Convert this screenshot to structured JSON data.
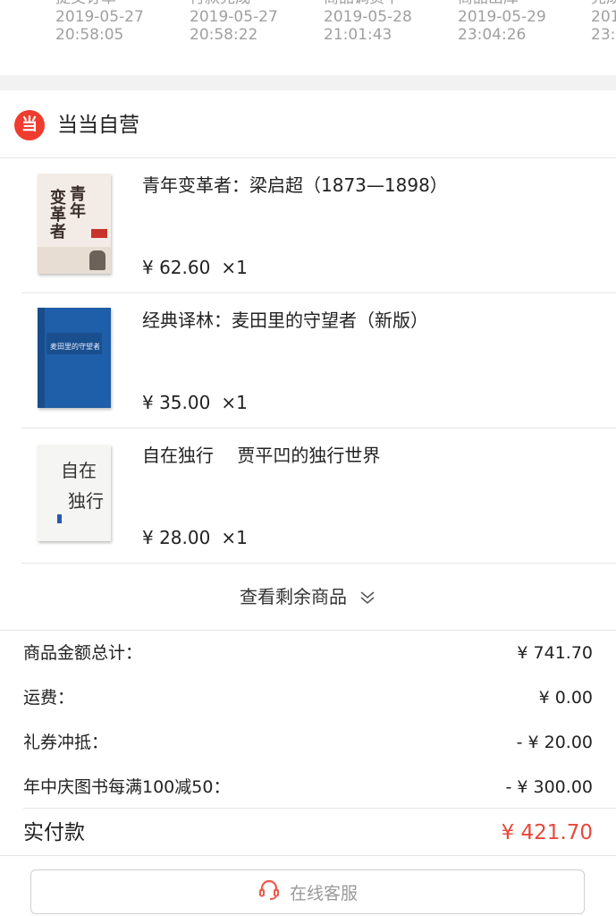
{
  "timeline": {
    "steps": [
      {
        "label": "提交订单",
        "date": "2019-05-27",
        "time": "20:58:05"
      },
      {
        "label": "付款完成",
        "date": "2019-05-27",
        "time": "20:58:22"
      },
      {
        "label": "商品调货中",
        "date": "2019-05-28",
        "time": "21:01:43"
      },
      {
        "label": "商品出库",
        "date": "2019-05-29",
        "time": "23:04:26"
      },
      {
        "label": "完成",
        "date": "201",
        "time": "23:5"
      }
    ]
  },
  "store": {
    "logo_char": "当",
    "name": "当当自营"
  },
  "items": [
    {
      "title": "青年变革者：梁启超（1873—1898）",
      "price": "¥ 62.60",
      "qty": "×1",
      "cover_text": "青年变革者"
    },
    {
      "title": "经典译林：麦田里的守望者（新版）",
      "price": "¥ 35.00",
      "qty": "×1",
      "cover_text": "麦田里的守望者"
    },
    {
      "title": "自在独行　 贾平凹的独行世界",
      "price": "¥ 28.00",
      "qty": "×1",
      "cover_text": "自在独行"
    }
  ],
  "show_more": {
    "label": "查看剩余商品"
  },
  "summary": [
    {
      "label": "商品金额总计：",
      "value": "¥ 741.70"
    },
    {
      "label": "运费：",
      "value": "¥ 0.00"
    },
    {
      "label": "礼券冲抵：",
      "value": "- ¥ 20.00"
    },
    {
      "label": "年中庆图书每满100减50：",
      "value": "- ¥ 300.00"
    }
  ],
  "total": {
    "label": "实付款",
    "value": "¥ 421.70"
  },
  "service": {
    "label": "在线客服"
  },
  "colors": {
    "accent_red": "#e8483b",
    "logo_red": "#ee3c2f"
  }
}
